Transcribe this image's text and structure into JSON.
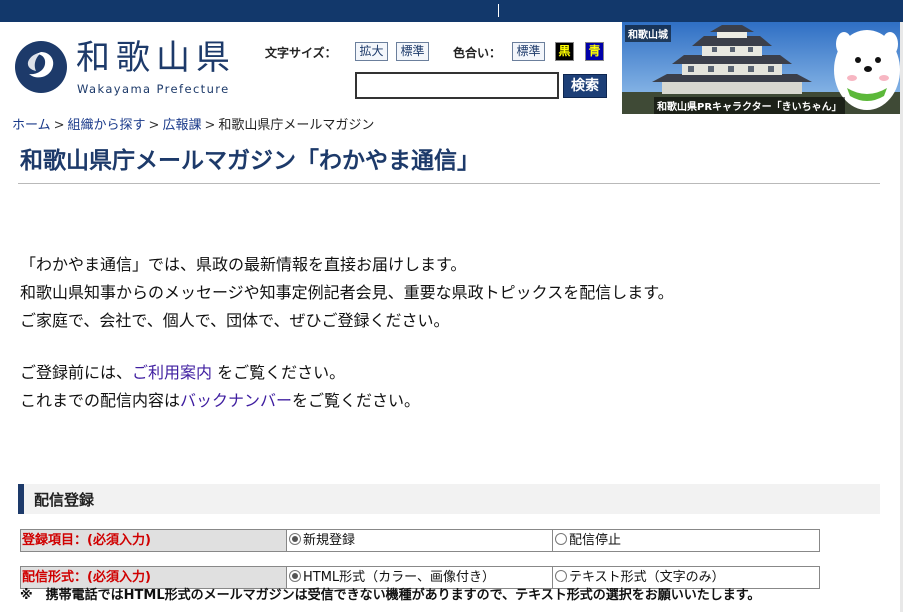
{
  "header": {
    "logo_jp": "和歌山県",
    "logo_en": "Wakayama Prefecture",
    "font_size_label": "文字サイズ：",
    "font_enlarge": "拡大",
    "font_standard": "標準",
    "color_label": "色合い：",
    "color_standard": "標準",
    "color_black": "黒",
    "color_blue": "青",
    "search_value": "",
    "search_button": "検索",
    "banner_castle": "和歌山城",
    "banner_character": "和歌山県PRキャラクター「きいちゃん」"
  },
  "breadcrumb": {
    "home": "ホーム",
    "org": "組織から探す",
    "pr": "広報課",
    "current": "和歌山県庁メールマガジン",
    "sep": ">"
  },
  "page": {
    "title": "和歌山県庁メールマガジン「わかやま通信」",
    "intro1": "「わかやま通信」では、県政の最新情報を直接お届けします。",
    "intro2": "和歌山県知事からのメッセージや知事定例記者会見、重要な県政トピックスを配信します。",
    "intro3": "ご家庭で、会社で、個人で、団体で、ぜひご登録ください。",
    "guide_pre": "ご登録前には、",
    "guide_link": "ご利用案内",
    "guide_post": " をご覧ください。",
    "back_pre": "これまでの配信内容は",
    "back_link": "バックナンバー",
    "back_post": "をご覧ください。"
  },
  "registration": {
    "section_title": "配信登録",
    "row1_label": "登録項目：(必須入力)",
    "row1_opt1": "新規登録",
    "row1_opt2": "配信停止",
    "row2_label": "配信形式：(必須入力)",
    "row2_opt1": "HTML形式（カラー、画像付き）",
    "row2_opt2": "テキスト形式（文字のみ）",
    "note": "※　携帯電話ではHTML形式のメールマガジンは受信できない機種がありますので、テキスト形式の選択をお願いいたします。"
  },
  "colors": {
    "brand_navy": "#1d3a6a",
    "required_red": "#d00000",
    "link_purple": "#3f1ea0"
  }
}
